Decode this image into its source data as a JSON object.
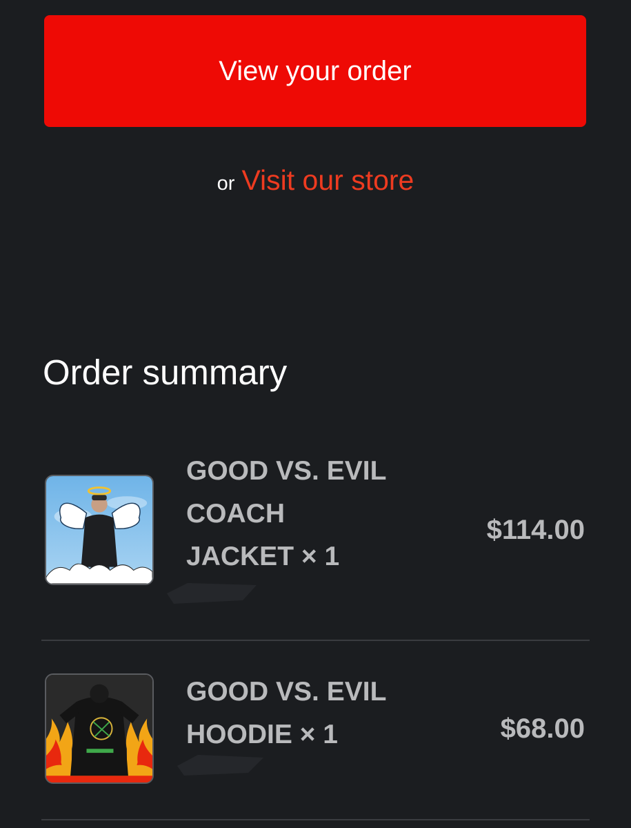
{
  "actions": {
    "view_order_label": "View your order",
    "or_text": "or",
    "visit_store_label": "Visit our store"
  },
  "colors": {
    "accent": "#ee0a05",
    "link": "#ee3b20",
    "background": "#1b1d20",
    "muted_text": "#b9babc"
  },
  "order_summary": {
    "title": "Order summary",
    "items": [
      {
        "name_lines": [
          "GOOD VS. EVIL",
          "COACH",
          "JACKET × 1"
        ],
        "price": "$114.00",
        "image": "angel-jacket-product-image"
      },
      {
        "name_lines": [
          "GOOD VS. EVIL",
          "HOODIE × 1"
        ],
        "price": "$68.00",
        "image": "flame-hoodie-product-image"
      }
    ]
  }
}
